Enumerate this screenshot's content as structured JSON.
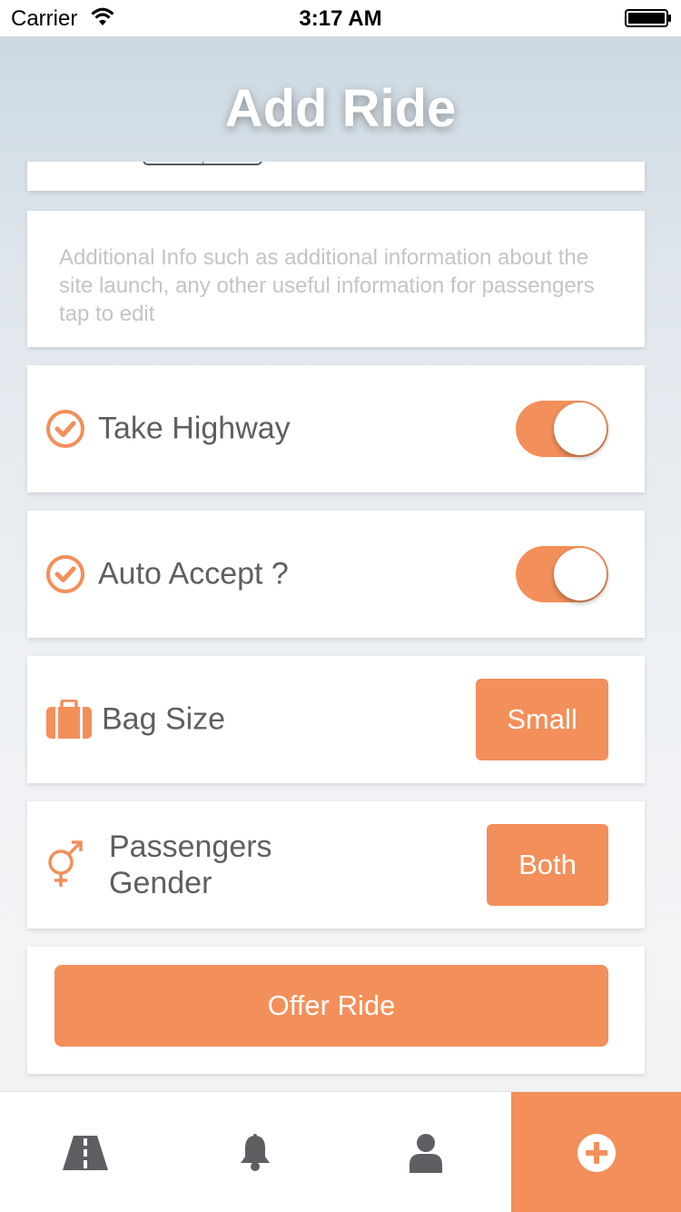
{
  "status_bar": {
    "carrier": "Carrier",
    "time": "3:17 AM"
  },
  "header": {
    "title": "Add Ride"
  },
  "additional_info": {
    "placeholder": "Additional Info such as additional information about the site launch, any other useful information for passengers  tap to edit"
  },
  "options": {
    "take_highway": {
      "label": "Take Highway",
      "enabled": true
    },
    "auto_accept": {
      "label": "Auto Accept ?",
      "enabled": true
    },
    "bag_size": {
      "label": "Bag Size",
      "value": "Small"
    },
    "passengers_gender": {
      "label_line1": "Passengers",
      "label_line2": "Gender",
      "value": "Both"
    }
  },
  "actions": {
    "offer_ride_label": "Offer Ride"
  },
  "tab_bar": {
    "tabs": [
      {
        "icon": "road-icon",
        "active": false
      },
      {
        "icon": "bell-icon",
        "active": false
      },
      {
        "icon": "user-icon",
        "active": false
      },
      {
        "icon": "add-circle-icon",
        "active": true
      }
    ]
  },
  "colors": {
    "accent": "#f38f5a",
    "text": "#5f5f63",
    "placeholder": "#c4c4c8"
  }
}
